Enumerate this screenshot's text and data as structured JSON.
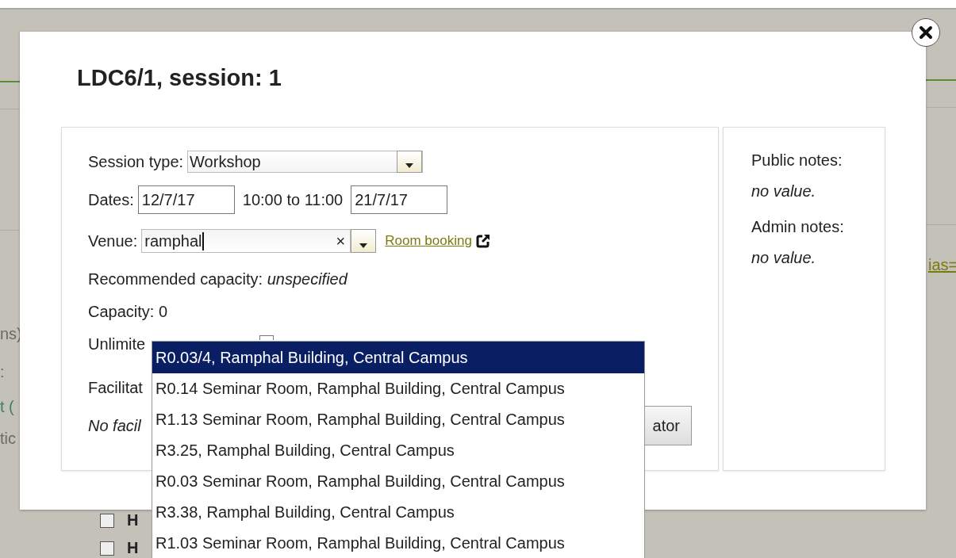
{
  "background": {
    "left_fragments": [
      "ns)",
      ":",
      "t (",
      "tic"
    ],
    "link": "ias=",
    "checkbox_rows": [
      {
        "label": "H",
        "checked": false
      },
      {
        "label": "H",
        "checked": false
      }
    ]
  },
  "dialog": {
    "title": "LDC6/1, session: 1",
    "form": {
      "session_type": {
        "label": "Session type:",
        "value": "Workshop"
      },
      "dates": {
        "label": "Dates:",
        "start": "12/7/17",
        "time": "10:00 to 11:00",
        "end": "21/7/17"
      },
      "venue": {
        "label": "Venue:",
        "value": "ramphal",
        "clear": "×",
        "link": "Room booking"
      },
      "recommended_capacity": {
        "label": "Recommended capacity:",
        "value": "unspecified"
      },
      "capacity": {
        "label": "Capacity:",
        "value": "0"
      },
      "unlimited": {
        "label": "Unlimite",
        "checked": false
      },
      "facilitators": {
        "label": "Facilitat"
      },
      "no_facilitators": "No facil",
      "add_button": "ator"
    },
    "notes": [
      {
        "label": "Public notes:",
        "value": "no value."
      },
      {
        "label": "Admin notes:",
        "value": "no value."
      }
    ],
    "venue_suggestions": [
      {
        "text": "R0.03/4, Ramphal Building, Central Campus",
        "selected": true
      },
      {
        "text": "R0.14 Seminar Room, Ramphal Building, Central Campus",
        "selected": false
      },
      {
        "text": "R1.13 Seminar Room, Ramphal Building, Central Campus",
        "selected": false
      },
      {
        "text": "R3.25, Ramphal Building, Central Campus",
        "selected": false
      },
      {
        "text": "R0.03 Seminar Room, Ramphal Building, Central Campus",
        "selected": false
      },
      {
        "text": "R3.38, Ramphal Building, Central Campus",
        "selected": false
      },
      {
        "text": "R1.03 Seminar Room, Ramphal Building, Central Campus",
        "selected": false
      }
    ]
  }
}
